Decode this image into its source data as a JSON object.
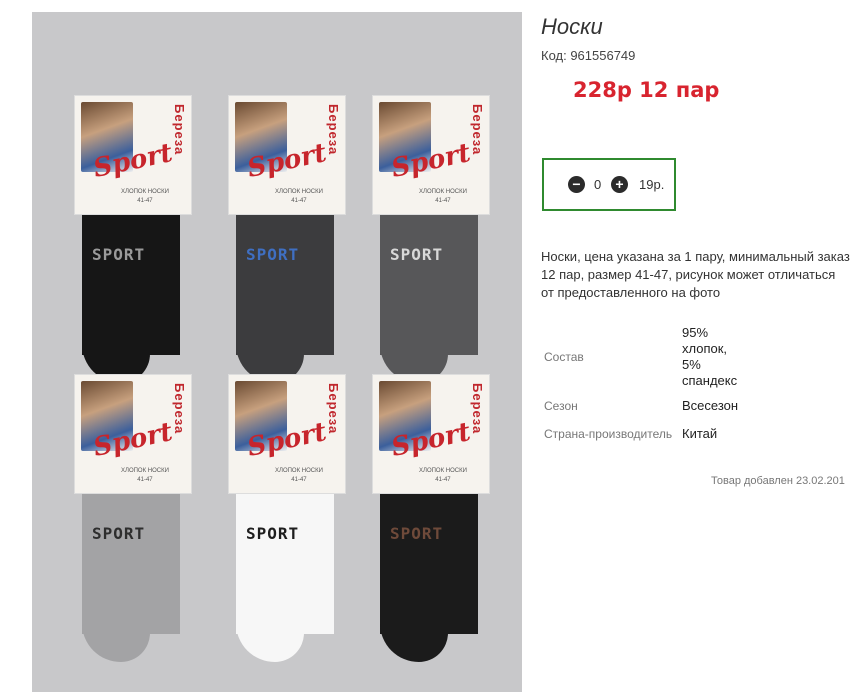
{
  "product": {
    "title": "Носки",
    "code": "Код: 961556749",
    "price_text": "228р 12 пар",
    "quantity": "0",
    "unit_price": "19р.",
    "description": "Носки, цена указана за 1 пару, минимальный заказ 12 пар, размер 41-47, рисунок может отличаться от предоставленного на фото",
    "added": "Товар добавлен 23.02.201"
  },
  "quantity_controls": {
    "minus_icon": "minus-circle-icon",
    "plus_icon": "plus-circle-icon"
  },
  "properties": [
    {
      "name": "Состав",
      "value": "95%\nхлопок,\n5%\nспандекс"
    },
    {
      "name": "Сезон",
      "value": "Всесезон"
    },
    {
      "name": "Страна-производитель",
      "value": "Китай"
    }
  ],
  "image": {
    "socks": [
      {
        "label": "SPORT",
        "sock_color": "#161616",
        "label_color": "#9a9a9a"
      },
      {
        "label": "SPORT",
        "sock_color": "#3c3c3e",
        "label_color": "#3f6fc2"
      },
      {
        "label": "SPORT",
        "sock_color": "#575759",
        "label_color": "#d8d8d8"
      },
      {
        "label": "SPORT",
        "sock_color": "#a3a3a5",
        "label_color": "#2e2e2e"
      },
      {
        "label": "SPORT",
        "sock_color": "#f7f7f7",
        "label_color": "#1e1e1e"
      },
      {
        "label": "SPORT",
        "sock_color": "#1b1b1b",
        "label_color": "#6e4a3a"
      }
    ],
    "tag_brand": "Береза",
    "tag_logo": "Sport",
    "tag_small": "ХЛОПОК НОСКИ\n41-47"
  },
  "colors": {
    "price": "#d8242f",
    "qty_border": "#2f8a2f",
    "photo_bg": "#c8c8ca"
  }
}
